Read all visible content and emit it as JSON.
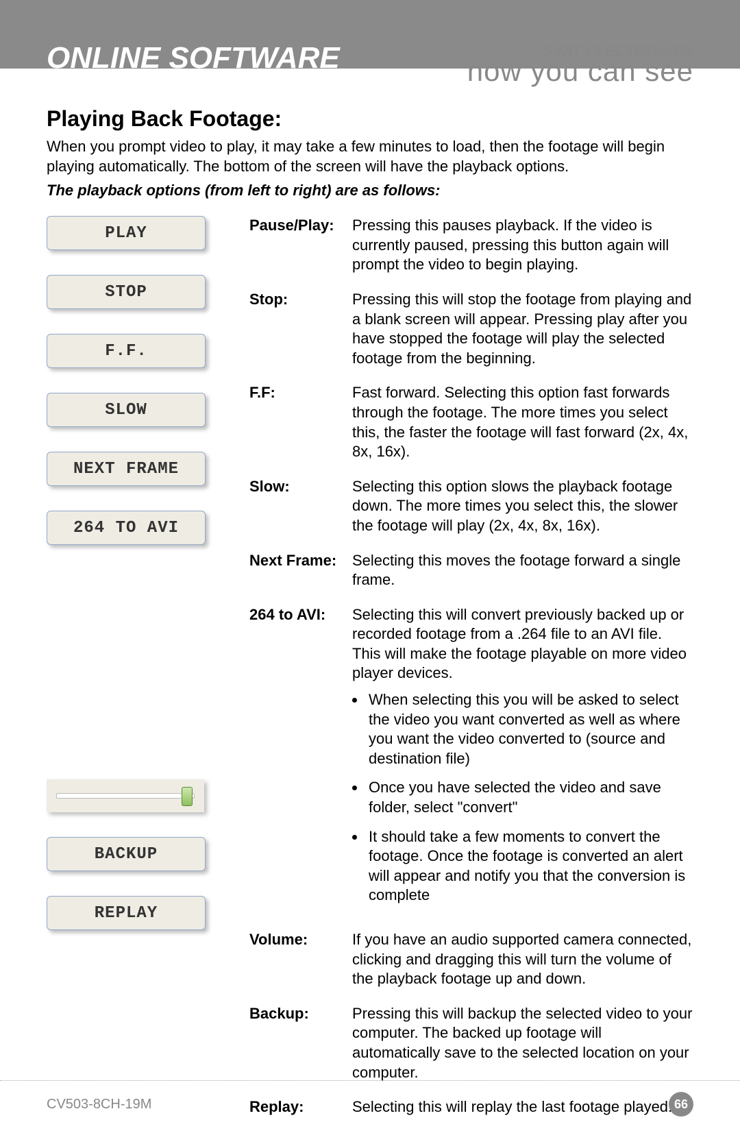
{
  "header": {
    "title": "ONLINE SOFTWARE",
    "brand_small": "SVAT ELECTRONICS",
    "brand_big": "now you can see"
  },
  "section": {
    "title": "Playing Back Footage:",
    "intro": "When you prompt video to play, it may take a few minutes to load, then the footage will begin playing automatically. The bottom of the screen will have the playback options.",
    "options_lead": "The playback options (from left to right) are as follows:"
  },
  "buttons": {
    "play": "PLAY",
    "stop": "STOP",
    "ff": "F.F.",
    "slow": "SLOW",
    "next_frame": "NEXT FRAME",
    "to_avi": "264 TO AVI",
    "backup": "BACKUP",
    "replay": "REPLAY"
  },
  "descriptions": {
    "pause_play": {
      "label": "Pause/Play:",
      "text": "Pressing this pauses playback. If the video is currently paused, pressing this button again will prompt the video to begin playing."
    },
    "stop": {
      "label": "Stop:",
      "text": "Pressing this will stop the footage from playing and a blank screen will appear. Pressing play after you have stopped the footage will play the selected footage from the beginning."
    },
    "ff": {
      "label": "F.F:",
      "text": "Fast forward. Selecting this option fast forwards through the footage. The more times you select this, the faster the footage will fast forward (2x, 4x, 8x, 16x)."
    },
    "slow": {
      "label": "Slow:",
      "text": "Selecting this option slows the playback footage down. The more times you select this, the slower the footage will play (2x, 4x, 8x, 16x)."
    },
    "next_frame": {
      "label": "Next Frame:",
      "text": "Selecting this moves the footage forward a single frame."
    },
    "to_avi": {
      "label": "264 to AVI:",
      "text": "Selecting this will convert previously backed up or recorded footage from a .264 file to an AVI file. This will make the footage playable on more video player devices.",
      "bullets": [
        "When selecting this you will be asked to select the video you want converted as well as where you want the video converted to (source and destination file)",
        "Once you have selected the video and save folder, select \"convert\"",
        "It should take a few moments to convert the footage. Once the footage is converted an alert will appear and notify you that the conversion is complete"
      ]
    },
    "volume": {
      "label": "Volume:",
      "text": "If you have an audio supported camera connected, clicking and dragging this will turn the volume of the playback footage up and down."
    },
    "backup": {
      "label": "Backup:",
      "text": "Pressing this will backup the selected video to your computer. The backed up footage will automatically save to the selected location on your computer."
    },
    "replay": {
      "label": "Replay:",
      "text": "Selecting this will replay the last footage played."
    }
  },
  "footer": {
    "model": "CV503-8CH-19M",
    "page": "66"
  }
}
